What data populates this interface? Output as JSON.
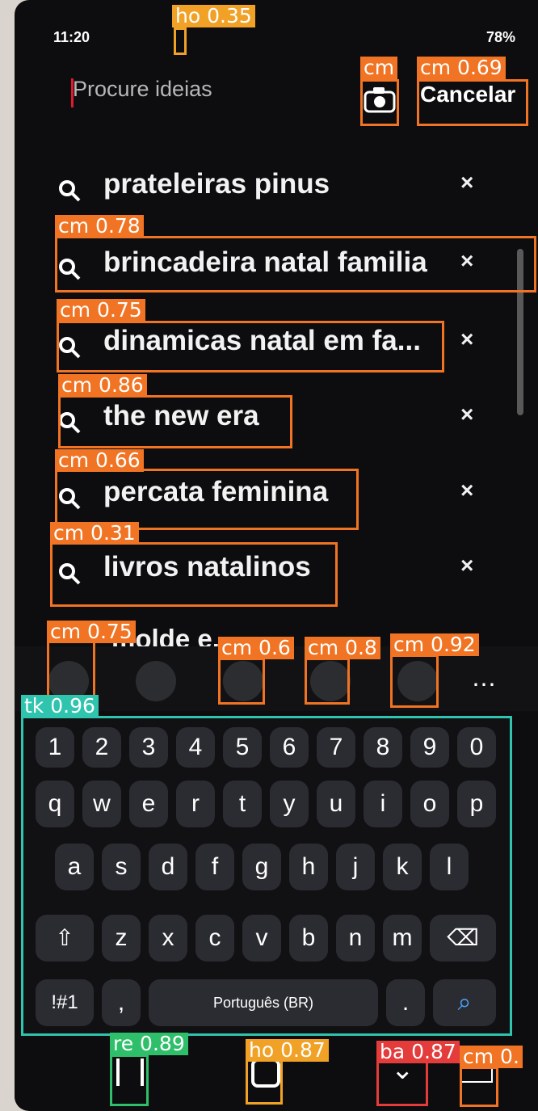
{
  "status_bar": {
    "time": "11:20",
    "battery": "78%"
  },
  "search": {
    "placeholder": "Procure ideias",
    "cancel_label": "Cancelar"
  },
  "suggestions": [
    "prateleiras pinus",
    "brincadeira natal familia",
    "dinamicas natal em fa...",
    "the new era",
    "percata feminina",
    "livros natalinos",
    "molde e..."
  ],
  "keyboard": {
    "numbers": [
      "1",
      "2",
      "3",
      "4",
      "5",
      "6",
      "7",
      "8",
      "9",
      "0"
    ],
    "row1": [
      "q",
      "w",
      "e",
      "r",
      "t",
      "y",
      "u",
      "i",
      "o",
      "p"
    ],
    "row2": [
      "a",
      "s",
      "d",
      "f",
      "g",
      "h",
      "j",
      "k",
      "l"
    ],
    "row3": [
      "z",
      "x",
      "c",
      "v",
      "b",
      "n",
      "m"
    ],
    "special": "!#1",
    "comma": ",",
    "space_label": "Português (BR)",
    "dot": "."
  },
  "annotations": {
    "ho1": "ho 0.35",
    "cm_camera": "cm",
    "cm_cancel": "cm 0.69",
    "cm1": "cm 0.78",
    "cm2": "cm 0.75",
    "cm3": "cm 0.86",
    "cm4": "cm 0.66",
    "cm5": "cm 0.31",
    "cm6": "cm 0.75",
    "cm7": "cm 0.6",
    "cm8": "cm 0.8",
    "cm9": "cm 0.92",
    "tk": "tk 0.96",
    "re": "re 0.89",
    "ho2": "ho 0.87",
    "ba": "ba 0.87",
    "cm10": "cm 0."
  }
}
